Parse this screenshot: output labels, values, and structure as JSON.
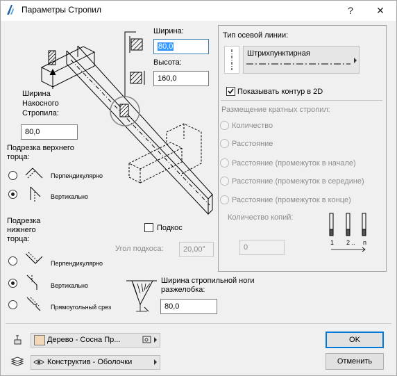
{
  "window": {
    "title": "Параметры Стропил",
    "help": "?",
    "close": "✕"
  },
  "left": {
    "inclined_width_label": "Ширина\nНакосного\nСтропила:",
    "inclined_width_value": "80,0",
    "width_label": "Ширина:",
    "width_value": "80,0",
    "height_label": "Высота:",
    "height_value": "160,0",
    "top_cut": {
      "label": "Подрезка верхнего\nторца:",
      "options": [
        {
          "label": "Перпендикулярно",
          "selected": false
        },
        {
          "label": "Вертикально",
          "selected": true
        }
      ]
    },
    "strut_checkbox": {
      "label": "Подкос",
      "checked": false
    },
    "strut_angle_label": "Угол подкоса:",
    "strut_angle_value": "20,00°",
    "bottom_cut": {
      "label": "Подрезка\nнижнего\nторца:",
      "options": [
        {
          "label": "Перпендикулярно",
          "selected": false
        },
        {
          "label": "Вертикально",
          "selected": true
        },
        {
          "label": "Прямоугольный срез",
          "selected": false
        }
      ]
    },
    "valley_width_label": "Ширина стропильной ноги\nразжелобка:",
    "valley_width_value": "80,0"
  },
  "right": {
    "axis_type_label": "Тип осевой линии:",
    "axis_type_value": "Штрихпунктирная",
    "show_contour": {
      "label": "Показывать контур в 2D",
      "checked": true
    },
    "placement_label": "Размещение кратных стропил:",
    "placement_options": [
      "Количество",
      "Расстояние",
      "Расстояние (промежуток в начале)",
      "Расстояние (промежуток в середине)",
      "Расстояние (промежуток в конце)"
    ],
    "copies_label": "Количество копий:",
    "copies_value": "0",
    "copies_icon_labels": [
      "1",
      "2 ..",
      "n"
    ]
  },
  "footer": {
    "material": "Дерево - Сосна Пр...",
    "layer": "Конструктив - Оболочки",
    "ok": "OK",
    "cancel": "Отменить"
  },
  "colors": {
    "accent": "#0078d7",
    "material_swatch": "#f0d8b8",
    "selection": "#3399ff"
  }
}
